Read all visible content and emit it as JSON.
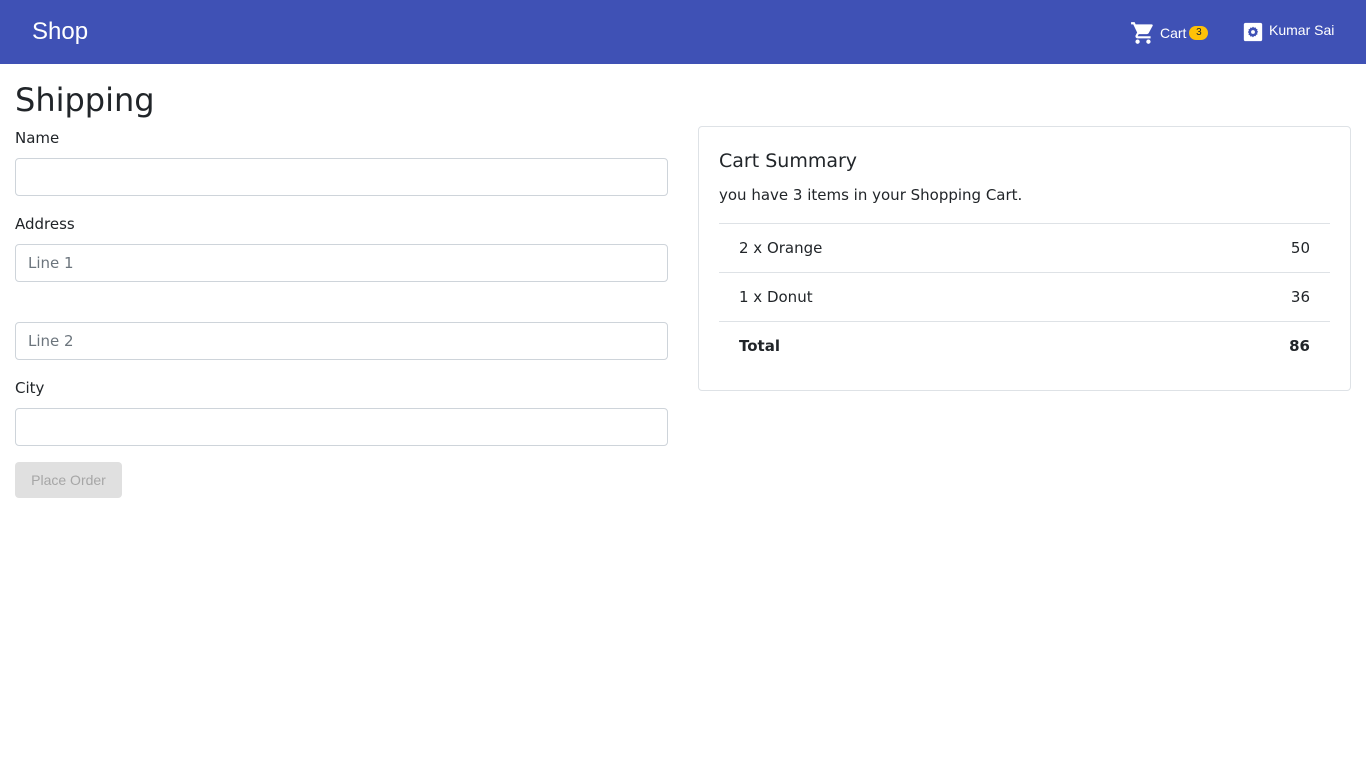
{
  "appbar": {
    "brand": "Shop",
    "cart_label": "Cart",
    "cart_count": "3",
    "user_name": "Kumar Sai",
    "bg_color": "#3f51b5",
    "badge_color": "#ffc107"
  },
  "shipping": {
    "title": "Shipping",
    "name_label": "Name",
    "name_value": "",
    "address_label": "Address",
    "line1_placeholder": "Line 1",
    "line2_placeholder": "Line 2",
    "city_label": "City",
    "city_value": "",
    "place_order_label": "Place Order"
  },
  "cart_summary": {
    "title": "Cart Summary",
    "subtitle": "you have 3 items in your Shopping Cart.",
    "items": [
      {
        "label": "2 x Orange",
        "amount": "50"
      },
      {
        "label": "1 x Donut",
        "amount": "36"
      }
    ],
    "total_label": "Total",
    "total_amount": "86"
  }
}
